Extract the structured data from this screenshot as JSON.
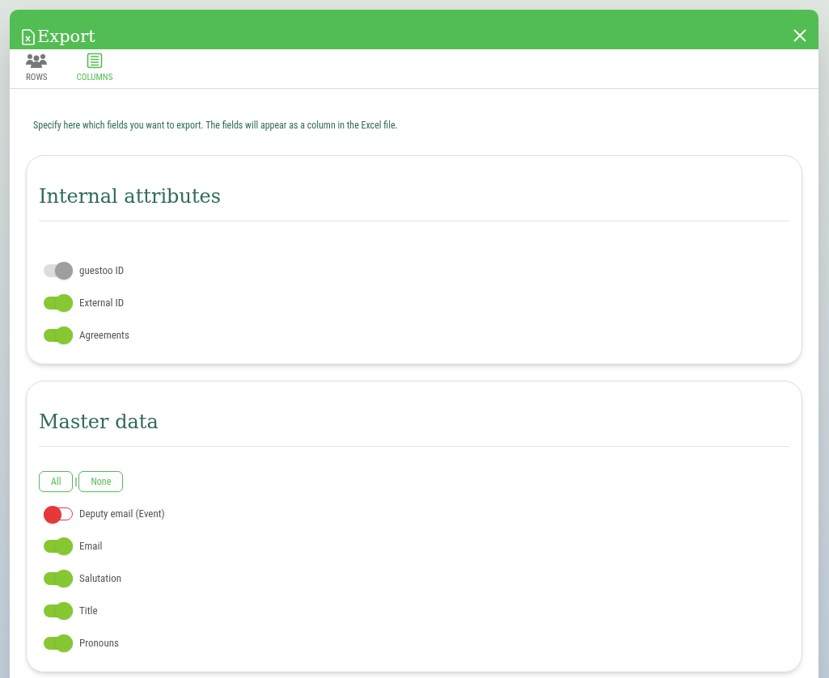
{
  "window": {
    "title": "Export"
  },
  "tabs": [
    {
      "label": "ROWS",
      "kind": "people",
      "selected": false
    },
    {
      "label": "COLUMNS",
      "kind": "table",
      "selected": true
    }
  ],
  "intro": "Specify here which fields you want to export. The fields will appear as a column in the Excel file.",
  "sections": [
    {
      "title": "Internal attributes",
      "fields": [
        {
          "label": "guestoo ID",
          "on": true,
          "disabled": true
        },
        {
          "label": "External ID",
          "on": true,
          "disabled": false
        },
        {
          "label": "Agreements",
          "on": true,
          "disabled": false
        }
      ]
    },
    {
      "title": "Master data",
      "actions": [
        "All",
        "None"
      ],
      "separator": "|",
      "fields": [
        {
          "label": "Deputy email (Event)",
          "on": false,
          "disabled": false
        },
        {
          "label": "Email",
          "on": true,
          "disabled": false
        },
        {
          "label": "Salutation",
          "on": true,
          "disabled": false
        },
        {
          "label": "Title",
          "on": true,
          "disabled": false
        },
        {
          "label": "Pronouns",
          "on": true,
          "disabled": false
        }
      ]
    }
  ]
}
